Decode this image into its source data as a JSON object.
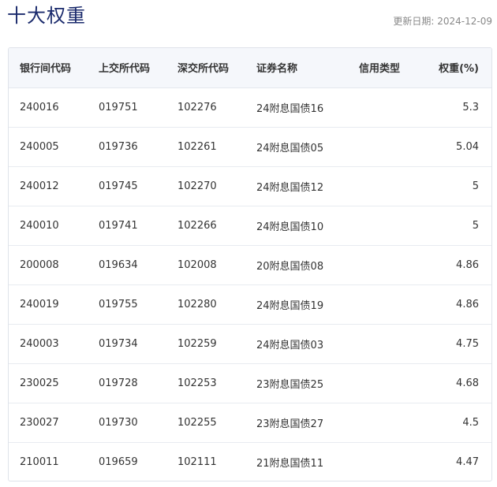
{
  "page": {
    "title": "十大权重",
    "update_date": "更新日期: 2024-12-09"
  },
  "table": {
    "columns": [
      "银行间代码",
      "上交所代码",
      "深交所代码",
      "证券名称",
      "信用类型",
      "权重(%)"
    ],
    "rows": [
      {
        "bank": "240016",
        "sh": "019751",
        "sz": "102276",
        "name": "24附息国债16",
        "credit": "",
        "weight": "5.3"
      },
      {
        "bank": "240005",
        "sh": "019736",
        "sz": "102261",
        "name": "24附息国债05",
        "credit": "",
        "weight": "5.04"
      },
      {
        "bank": "240012",
        "sh": "019745",
        "sz": "102270",
        "name": "24附息国债12",
        "credit": "",
        "weight": "5"
      },
      {
        "bank": "240010",
        "sh": "019741",
        "sz": "102266",
        "name": "24附息国债10",
        "credit": "",
        "weight": "5"
      },
      {
        "bank": "200008",
        "sh": "019634",
        "sz": "102008",
        "name": "20附息国债08",
        "credit": "",
        "weight": "4.86"
      },
      {
        "bank": "240019",
        "sh": "019755",
        "sz": "102280",
        "name": "24附息国债19",
        "credit": "",
        "weight": "4.86"
      },
      {
        "bank": "240003",
        "sh": "019734",
        "sz": "102259",
        "name": "24附息国债03",
        "credit": "",
        "weight": "4.75"
      },
      {
        "bank": "230025",
        "sh": "019728",
        "sz": "102253",
        "name": "23附息国债25",
        "credit": "",
        "weight": "4.68"
      },
      {
        "bank": "230027",
        "sh": "019730",
        "sz": "102255",
        "name": "23附息国债27",
        "credit": "",
        "weight": "4.5"
      },
      {
        "bank": "210011",
        "sh": "019659",
        "sz": "102111",
        "name": "21附息国债11",
        "credit": "",
        "weight": "4.47"
      }
    ]
  }
}
